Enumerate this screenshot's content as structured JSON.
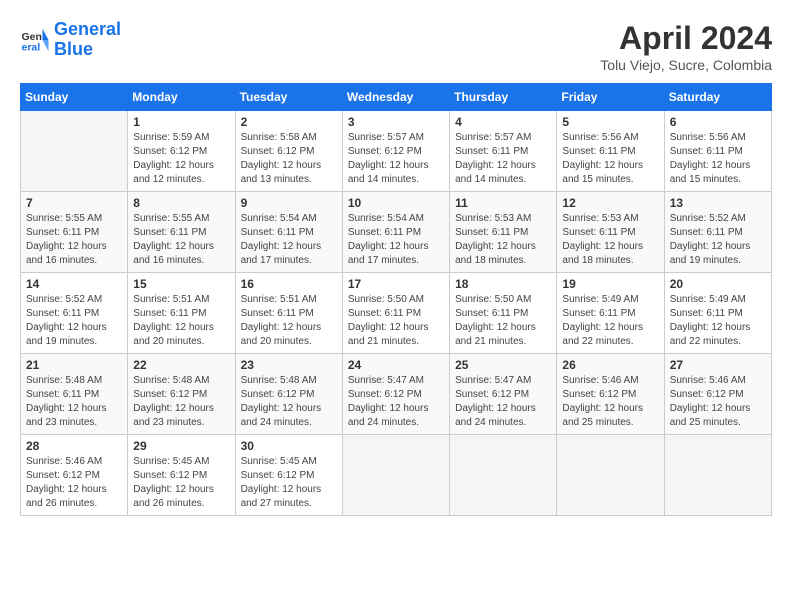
{
  "header": {
    "logo_line1": "General",
    "logo_line2": "Blue",
    "month_title": "April 2024",
    "subtitle": "Tolu Viejo, Sucre, Colombia"
  },
  "days_of_week": [
    "Sunday",
    "Monday",
    "Tuesday",
    "Wednesday",
    "Thursday",
    "Friday",
    "Saturday"
  ],
  "weeks": [
    [
      {
        "day": "",
        "info": ""
      },
      {
        "day": "1",
        "info": "Sunrise: 5:59 AM\nSunset: 6:12 PM\nDaylight: 12 hours\nand 12 minutes."
      },
      {
        "day": "2",
        "info": "Sunrise: 5:58 AM\nSunset: 6:12 PM\nDaylight: 12 hours\nand 13 minutes."
      },
      {
        "day": "3",
        "info": "Sunrise: 5:57 AM\nSunset: 6:12 PM\nDaylight: 12 hours\nand 14 minutes."
      },
      {
        "day": "4",
        "info": "Sunrise: 5:57 AM\nSunset: 6:11 PM\nDaylight: 12 hours\nand 14 minutes."
      },
      {
        "day": "5",
        "info": "Sunrise: 5:56 AM\nSunset: 6:11 PM\nDaylight: 12 hours\nand 15 minutes."
      },
      {
        "day": "6",
        "info": "Sunrise: 5:56 AM\nSunset: 6:11 PM\nDaylight: 12 hours\nand 15 minutes."
      }
    ],
    [
      {
        "day": "7",
        "info": "Sunrise: 5:55 AM\nSunset: 6:11 PM\nDaylight: 12 hours\nand 16 minutes."
      },
      {
        "day": "8",
        "info": "Sunrise: 5:55 AM\nSunset: 6:11 PM\nDaylight: 12 hours\nand 16 minutes."
      },
      {
        "day": "9",
        "info": "Sunrise: 5:54 AM\nSunset: 6:11 PM\nDaylight: 12 hours\nand 17 minutes."
      },
      {
        "day": "10",
        "info": "Sunrise: 5:54 AM\nSunset: 6:11 PM\nDaylight: 12 hours\nand 17 minutes."
      },
      {
        "day": "11",
        "info": "Sunrise: 5:53 AM\nSunset: 6:11 PM\nDaylight: 12 hours\nand 18 minutes."
      },
      {
        "day": "12",
        "info": "Sunrise: 5:53 AM\nSunset: 6:11 PM\nDaylight: 12 hours\nand 18 minutes."
      },
      {
        "day": "13",
        "info": "Sunrise: 5:52 AM\nSunset: 6:11 PM\nDaylight: 12 hours\nand 19 minutes."
      }
    ],
    [
      {
        "day": "14",
        "info": "Sunrise: 5:52 AM\nSunset: 6:11 PM\nDaylight: 12 hours\nand 19 minutes."
      },
      {
        "day": "15",
        "info": "Sunrise: 5:51 AM\nSunset: 6:11 PM\nDaylight: 12 hours\nand 20 minutes."
      },
      {
        "day": "16",
        "info": "Sunrise: 5:51 AM\nSunset: 6:11 PM\nDaylight: 12 hours\nand 20 minutes."
      },
      {
        "day": "17",
        "info": "Sunrise: 5:50 AM\nSunset: 6:11 PM\nDaylight: 12 hours\nand 21 minutes."
      },
      {
        "day": "18",
        "info": "Sunrise: 5:50 AM\nSunset: 6:11 PM\nDaylight: 12 hours\nand 21 minutes."
      },
      {
        "day": "19",
        "info": "Sunrise: 5:49 AM\nSunset: 6:11 PM\nDaylight: 12 hours\nand 22 minutes."
      },
      {
        "day": "20",
        "info": "Sunrise: 5:49 AM\nSunset: 6:11 PM\nDaylight: 12 hours\nand 22 minutes."
      }
    ],
    [
      {
        "day": "21",
        "info": "Sunrise: 5:48 AM\nSunset: 6:11 PM\nDaylight: 12 hours\nand 23 minutes."
      },
      {
        "day": "22",
        "info": "Sunrise: 5:48 AM\nSunset: 6:12 PM\nDaylight: 12 hours\nand 23 minutes."
      },
      {
        "day": "23",
        "info": "Sunrise: 5:48 AM\nSunset: 6:12 PM\nDaylight: 12 hours\nand 24 minutes."
      },
      {
        "day": "24",
        "info": "Sunrise: 5:47 AM\nSunset: 6:12 PM\nDaylight: 12 hours\nand 24 minutes."
      },
      {
        "day": "25",
        "info": "Sunrise: 5:47 AM\nSunset: 6:12 PM\nDaylight: 12 hours\nand 24 minutes."
      },
      {
        "day": "26",
        "info": "Sunrise: 5:46 AM\nSunset: 6:12 PM\nDaylight: 12 hours\nand 25 minutes."
      },
      {
        "day": "27",
        "info": "Sunrise: 5:46 AM\nSunset: 6:12 PM\nDaylight: 12 hours\nand 25 minutes."
      }
    ],
    [
      {
        "day": "28",
        "info": "Sunrise: 5:46 AM\nSunset: 6:12 PM\nDaylight: 12 hours\nand 26 minutes."
      },
      {
        "day": "29",
        "info": "Sunrise: 5:45 AM\nSunset: 6:12 PM\nDaylight: 12 hours\nand 26 minutes."
      },
      {
        "day": "30",
        "info": "Sunrise: 5:45 AM\nSunset: 6:12 PM\nDaylight: 12 hours\nand 27 minutes."
      },
      {
        "day": "",
        "info": ""
      },
      {
        "day": "",
        "info": ""
      },
      {
        "day": "",
        "info": ""
      },
      {
        "day": "",
        "info": ""
      }
    ]
  ]
}
